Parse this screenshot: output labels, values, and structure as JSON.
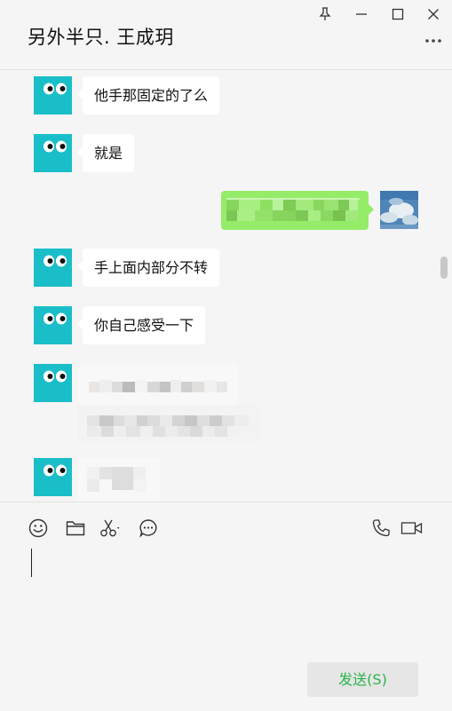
{
  "window": {
    "title": "另外半只. 王成玥"
  },
  "messages": [
    {
      "sender": "other",
      "text": "他手那固定的了么"
    },
    {
      "sender": "other",
      "text": "就是"
    },
    {
      "sender": "self",
      "text": ""
    },
    {
      "sender": "other",
      "text": "手上面内部分不转"
    },
    {
      "sender": "other",
      "text": "你自己感受一下"
    },
    {
      "sender": "other",
      "text": ""
    },
    {
      "sender": "other",
      "text": ""
    }
  ],
  "input": {
    "value": ""
  },
  "toolbar": {
    "send_label": "发送(S)",
    "icons": [
      "emoji-icon",
      "folder-icon",
      "scissors-icon",
      "chat-history-icon",
      "phone-icon",
      "video-icon"
    ]
  },
  "colors": {
    "avatar": "#19bec8",
    "outgoing_bubble": "#95ec69",
    "send_text": "#2bb34b",
    "background": "#f5f5f5"
  }
}
